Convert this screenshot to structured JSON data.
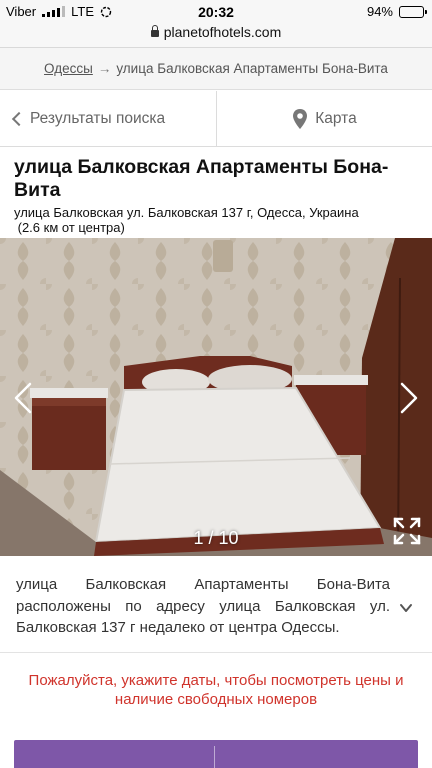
{
  "status_bar": {
    "carrier": "Viber",
    "network": "LTE",
    "time": "20:32",
    "battery": "94%",
    "battery_level": 0.94
  },
  "browser": {
    "url": "planetofhotels.com"
  },
  "breadcrumb": {
    "parent": "Одессы",
    "separator": "→",
    "current": "улица Балковская Апартаменты Бона-Вита"
  },
  "nav": {
    "back_label": "Результаты поиска",
    "map_label": "Карта"
  },
  "hotel": {
    "title": "улица Балковская Апартаменты Бона-Вита",
    "address": "улица Балковская ул. Балковская 137 г, Одесса, Украина",
    "distance": "(2.6 км от центра)"
  },
  "gallery": {
    "counter": "1 / 10"
  },
  "description": {
    "text": "улица Балковская Апартаменты Бона-Вита расположены по адресу улица Балковская ул. Балковская 137 г недалеко от центра Одессы."
  },
  "notice": {
    "text": "Пожалуйста, укажите даты, чтобы посмотреть цены и наличие свободных номеров"
  },
  "colors": {
    "notice_red": "#d0342c",
    "booking_purple": "#7e57a8"
  },
  "icons": {
    "back": "chevron-left-icon",
    "map": "map-pin-icon",
    "prev": "chevron-left-icon",
    "next": "chevron-right-icon",
    "fullscreen": "fullscreen-icon",
    "expand": "chevron-down-icon",
    "lock": "lock-icon"
  }
}
